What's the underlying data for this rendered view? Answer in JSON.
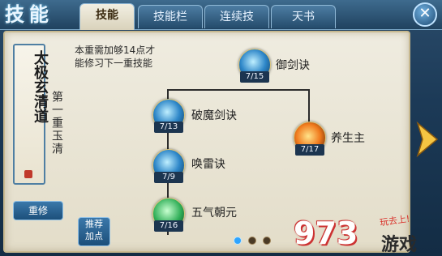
{
  "window": {
    "title": "技能",
    "close_icon": "close-icon"
  },
  "tabs": [
    {
      "label": "技能",
      "active": true
    },
    {
      "label": "技能栏",
      "active": false
    },
    {
      "label": "连续技",
      "active": false
    },
    {
      "label": "天书",
      "active": false
    }
  ],
  "scroll": {
    "title": "太极玄清道"
  },
  "level": {
    "label": "第一重玉清"
  },
  "description": {
    "line1": "本重需加够14点才",
    "line2": "能修习下一重技能"
  },
  "buttons": {
    "reset": "重修",
    "recommend_line1": "推荐",
    "recommend_line2": "加点"
  },
  "skills": [
    {
      "name": "御剑诀",
      "count": "7/15",
      "icon": "sword-skill-icon",
      "style": "blue"
    },
    {
      "name": "破魔剑诀",
      "count": "7/13",
      "icon": "demon-slaying-sword-icon",
      "style": "blue"
    },
    {
      "name": "养生主",
      "count": "7/17",
      "icon": "flame-skill-icon",
      "style": "fire"
    },
    {
      "name": "唤雷诀",
      "count": "7/9",
      "icon": "thunder-skill-icon",
      "style": "blue"
    },
    {
      "name": "五气朝元",
      "count": "7/16",
      "icon": "qi-aura-skill-icon",
      "style": "green"
    }
  ],
  "pagination": {
    "pages": 3,
    "current": 1
  },
  "watermark": {
    "number": "973",
    "text": "游戏",
    "slogan": "玩去上!"
  },
  "colors": {
    "accent": "#2ea4ff",
    "panel": "#efece0",
    "frame": "#1c3a57"
  }
}
